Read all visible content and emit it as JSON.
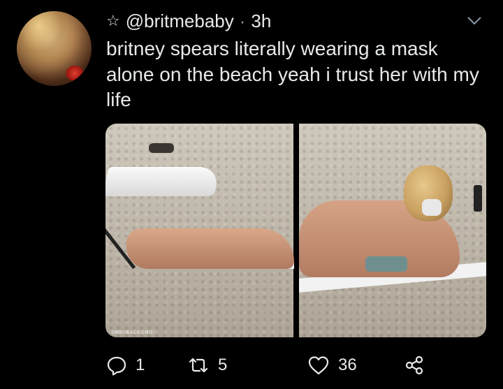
{
  "tweet": {
    "handle": "@britmebaby",
    "separator": "·",
    "time": "3h",
    "text": "britney spears literally wearing a mask alone on the beach yeah i trust her with my life",
    "media_watermark": "SMBI/BACKGRID"
  },
  "actions": {
    "reply_count": "1",
    "retweet_count": "5",
    "like_count": "36"
  },
  "icons": {
    "star": "star-icon",
    "chevron": "chevron-down-icon",
    "reply": "reply-icon",
    "retweet": "retweet-icon",
    "like": "heart-icon",
    "share": "share-icon"
  },
  "colors": {
    "background": "#000000",
    "text": "#e7e9ea",
    "secondary": "#8b98a5"
  }
}
